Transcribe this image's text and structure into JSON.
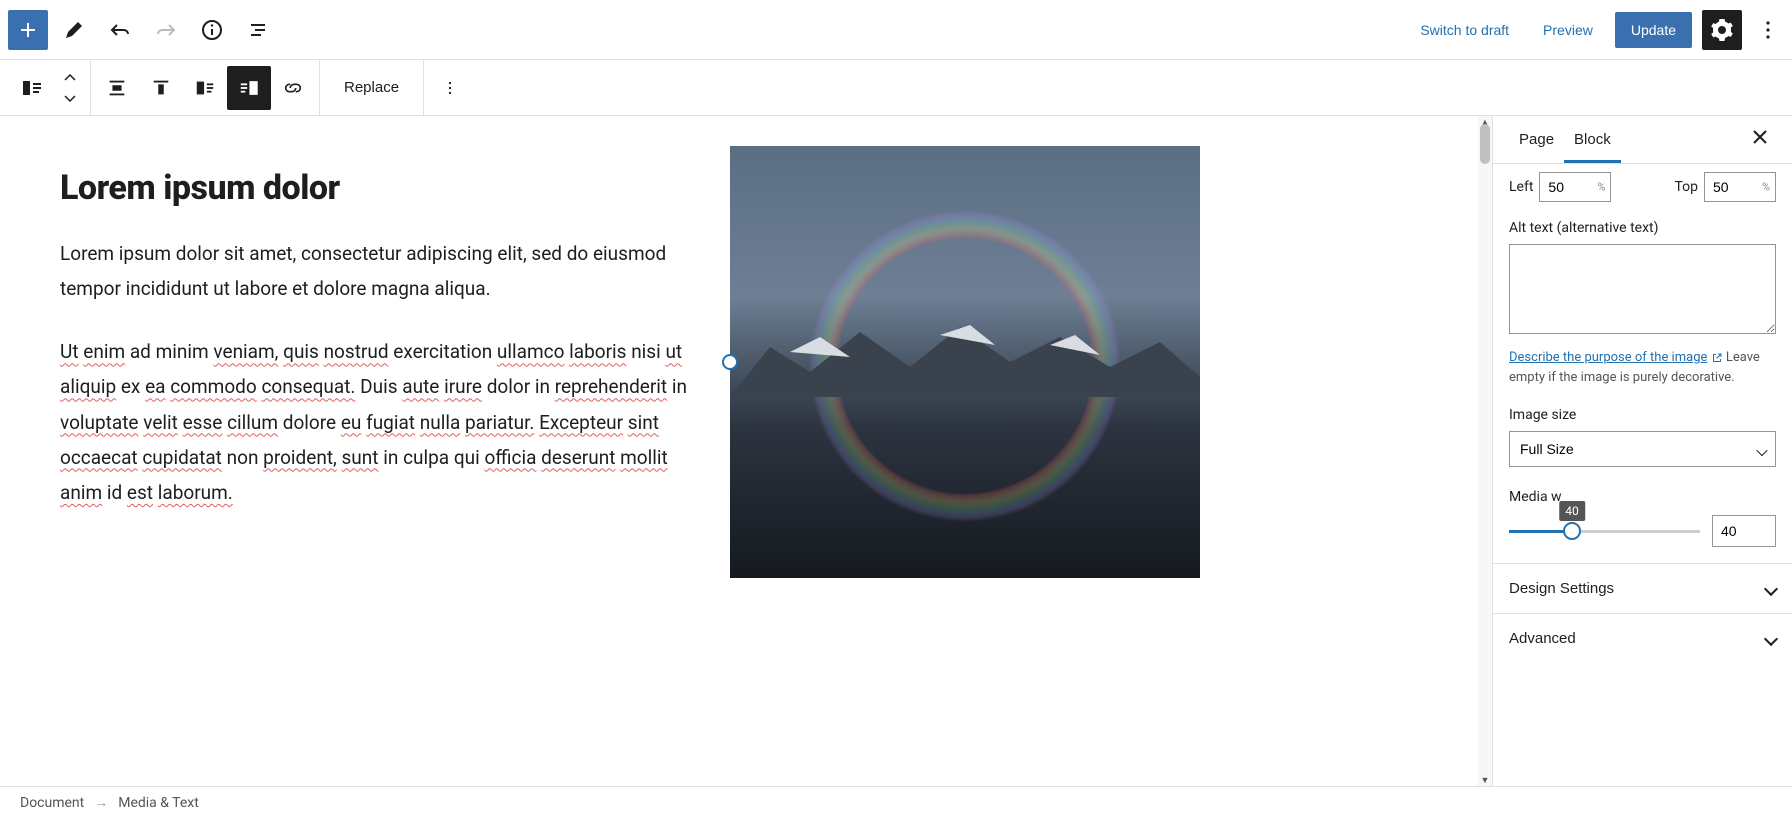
{
  "header": {
    "switch_to_draft": "Switch to draft",
    "preview": "Preview",
    "update": "Update"
  },
  "block_toolbar": {
    "replace": "Replace"
  },
  "content": {
    "heading": "Lorem ipsum dolor",
    "p1_parts": [
      "Lorem ipsum dolor sit amet, consectetur adipiscing elit, sed do eiusmod tempor incididunt ut labore et dolore magna aliqua."
    ],
    "p2": "Ut enim ad minim veniam, quis nostrud exercitation ullamco laboris nisi ut aliquip ex ea commodo consequat. Duis aute irure dolor in reprehenderit in voluptate velit esse cillum dolore eu fugiat nulla pariatur. Excepteur sint occaecat cupidatat non proident, sunt in culpa qui officia deserunt mollit anim id est laborum."
  },
  "sidebar": {
    "tabs": {
      "page": "Page",
      "block": "Block"
    },
    "focal": {
      "left_label": "Left",
      "left_value": "50",
      "top_label": "Top",
      "top_value": "50",
      "pct": "%"
    },
    "alt": {
      "label": "Alt text (alternative text)",
      "value": "",
      "link": "Describe the purpose of the image",
      "help_rest": " Leave empty if the image is purely decorative."
    },
    "image_size": {
      "label": "Image size",
      "value": "Full Size"
    },
    "media_width": {
      "label": "Media w",
      "tooltip": "40",
      "value": "40",
      "percent": 33
    },
    "panels": {
      "design": "Design Settings",
      "advanced": "Advanced"
    }
  },
  "footer": {
    "root": "Document",
    "arrow": "→",
    "current": "Media & Text"
  }
}
